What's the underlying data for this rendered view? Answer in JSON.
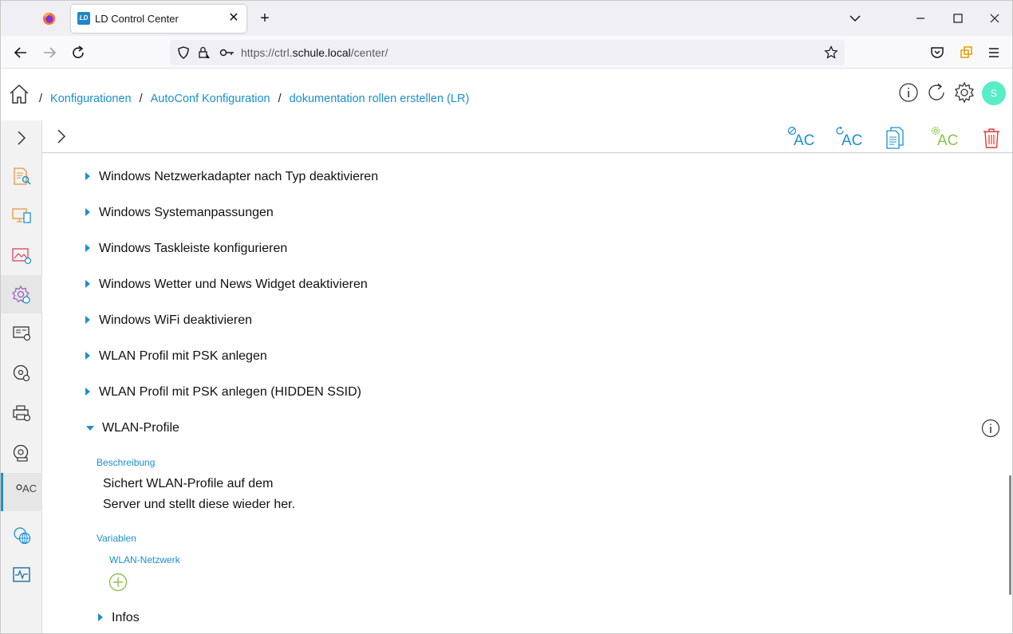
{
  "browser": {
    "tab_title": "LD Control Center",
    "tab_favicon_text": "LD",
    "url_prefix": "https://ctrl.",
    "url_domain": "schule.local",
    "url_path": "/center/"
  },
  "breadcrumb": {
    "items": [
      "Konfigurationen",
      "AutoConf Konfiguration",
      "dokumentation rollen erstellen (LR)"
    ],
    "separator": "/"
  },
  "header": {
    "avatar_initial": "S"
  },
  "sidebar": {
    "items": [
      {
        "icon": "document-search-icon"
      },
      {
        "icon": "devices-icon"
      },
      {
        "icon": "image-settings-icon"
      },
      {
        "icon": "gear-config-icon"
      },
      {
        "icon": "computer-list-icon"
      },
      {
        "icon": "disc-settings-icon"
      },
      {
        "icon": "printer-settings-icon"
      },
      {
        "icon": "disk-icon"
      },
      {
        "icon": "autoconf-icon",
        "label": "AC",
        "active": true
      },
      {
        "icon": "network-gear-icon"
      },
      {
        "icon": "monitor-activity-icon"
      }
    ]
  },
  "toolbar": {
    "buttons": [
      {
        "name": "ac-disable-button",
        "label": "AC"
      },
      {
        "name": "ac-refresh-button",
        "label": "AC"
      },
      {
        "name": "document-button",
        "label": ""
      },
      {
        "name": "ac-settings-button",
        "label": "AC"
      },
      {
        "name": "delete-button",
        "label": ""
      }
    ]
  },
  "list": {
    "items": [
      "Windows Netzwerkadapter nach Typ deaktivieren",
      "Windows Systemanpassungen",
      "Windows Taskleiste konfigurieren",
      "Windows Wetter und News Widget deaktivieren",
      "Windows WiFi deaktivieren",
      "WLAN Profil mit PSK anlegen",
      "WLAN Profil mit PSK anlegen (HIDDEN SSID)"
    ],
    "expanded": {
      "title": "WLAN-Profile",
      "description_label": "Beschreibung",
      "description_line1": "Sichert WLAN-Profile auf dem",
      "description_line2": "Server und stellt diese wieder her.",
      "variables_label": "Variablen",
      "variable_name": "WLAN-Netzwerk",
      "infos_label": "Infos"
    }
  },
  "colors": {
    "accent": "#1a8fd1",
    "ac_green": "#8bc34a",
    "delete_red": "#e53935",
    "avatar": "#58ecc7"
  }
}
